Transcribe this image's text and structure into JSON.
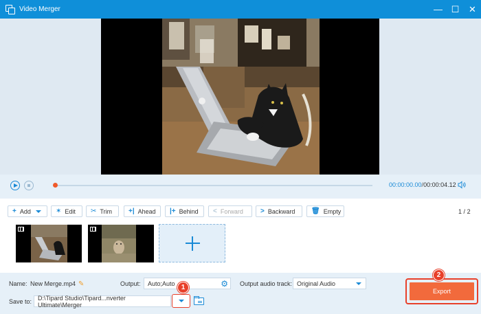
{
  "window": {
    "title": "Video Merger",
    "controls": [
      "minimize-icon",
      "maximize-icon",
      "close-icon"
    ]
  },
  "player": {
    "current_time": "00:00:00.00",
    "separator": "/",
    "total_time": "00:00:04.12",
    "progress": 0
  },
  "toolbar": {
    "add_label": "Add",
    "edit_label": "Edit",
    "trim_label": "Trim",
    "ahead_label": "Ahead",
    "behind_label": "Behind",
    "forward_label": "Forward",
    "backward_label": "Backward",
    "empty_label": "Empty"
  },
  "pagination": {
    "current": "1",
    "separator": "/",
    "total": "2"
  },
  "clips": [
    {
      "name": "clip-cat-laptop",
      "icon": "film-icon"
    },
    {
      "name": "clip-dog",
      "icon": "film-icon"
    }
  ],
  "settings": {
    "name_label": "Name:",
    "name_value": "New Merge.mp4",
    "output_label": "Output:",
    "output_value": "Auto;Auto",
    "audio_track_label": "Output audio track:",
    "audio_track_value": "Original Audio",
    "save_to_label": "Save to:",
    "save_to_value": "D:\\Tipard Studio\\Tipard...nverter Ultimate\\Merger",
    "export_label": "Export"
  },
  "markers": {
    "first": "1",
    "second": "2"
  },
  "colors": {
    "titlebar": "#0f8fd9",
    "accent": "#1a8ad6",
    "export": "#f26a3c",
    "highlight": "#e8402a"
  }
}
